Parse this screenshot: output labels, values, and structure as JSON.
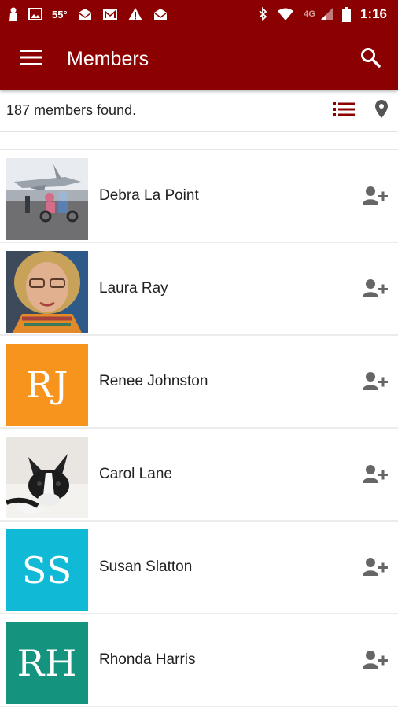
{
  "status_bar": {
    "temperature": "55°",
    "network": "4G",
    "time": "1:16",
    "icons": [
      "person-icon",
      "image-icon",
      "mail-icon",
      "gmail-icon",
      "warning-icon",
      "mail-icon",
      "bluetooth-icon",
      "wifi-icon",
      "signal-icon",
      "battery-icon"
    ]
  },
  "app_bar": {
    "title": "Members",
    "menu_icon": "hamburger-menu-icon",
    "search_icon": "search-icon"
  },
  "info_bar": {
    "count_text": "187 members found.",
    "list_view_icon": "list-icon",
    "map_view_icon": "map-pin-icon",
    "accent_color": "#8b0000"
  },
  "members": [
    {
      "name": "Debra La Point",
      "avatar_type": "photo",
      "photo": "jet-and-wheelchairs-photo"
    },
    {
      "name": "Laura Ray",
      "avatar_type": "photo",
      "photo": "woman-with-glasses-photo"
    },
    {
      "name": "Renee Johnston",
      "avatar_type": "initials",
      "initials": "RJ",
      "color": "#f7941d"
    },
    {
      "name": "Carol Lane",
      "avatar_type": "photo",
      "photo": "boston-terrier-photo"
    },
    {
      "name": "Susan Slatton",
      "avatar_type": "initials",
      "initials": "SS",
      "color": "#10b9d6"
    },
    {
      "name": "Rhonda Harris",
      "avatar_type": "initials",
      "initials": "RH",
      "color": "#14937f"
    }
  ],
  "add_friend_icon": "add-person-icon"
}
